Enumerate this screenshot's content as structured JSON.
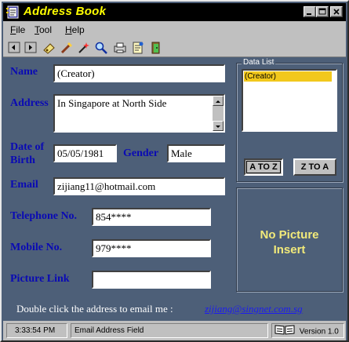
{
  "window": {
    "title": "Address Book"
  },
  "menu": [
    "File",
    "Tool",
    "Help"
  ],
  "toolbar": [
    "new-icon",
    "open-icon",
    "save-icon",
    "delete-icon",
    "magic-icon",
    "search-icon",
    "print-icon",
    "notes-icon",
    "exit-icon"
  ],
  "form": {
    "name_label": "Name",
    "name_value": "(Creator)",
    "address_label": "Address",
    "address_value": "In Singapore at North Side",
    "dob_label_1": "Date of",
    "dob_label_2": "Birth",
    "dob_value": "05/05/1981",
    "gender_label": "Gender",
    "gender_value": "Male",
    "email_label": "Email",
    "email_value": "zijiang11@hotmail.com",
    "telephone_label": "Telephone No.",
    "telephone_value": "854****",
    "mobile_label": "Mobile No.",
    "mobile_value": "979****",
    "picture_link_label": "Picture Link",
    "picture_link_value": ""
  },
  "data_list": {
    "title": "Data List",
    "items": [
      "(Creator)"
    ],
    "sort_a_to_z": "A TO Z",
    "sort_z_to_a": "Z TO A"
  },
  "picture": {
    "line1": "No Picture",
    "line2": "Insert"
  },
  "footer": {
    "hint": "Double click the address to email me :",
    "email": "zijiang@singnet.com.sg"
  },
  "status": {
    "time": "3:33:54 PM",
    "field": "Email Address Field",
    "version": "Version 1.0"
  },
  "colors": {
    "background": "#4d5f78",
    "title_text": "#ffff00",
    "label": "#0a0ab4",
    "selected_item": "#f2c81c",
    "picture_text": "#f2ea7a"
  }
}
